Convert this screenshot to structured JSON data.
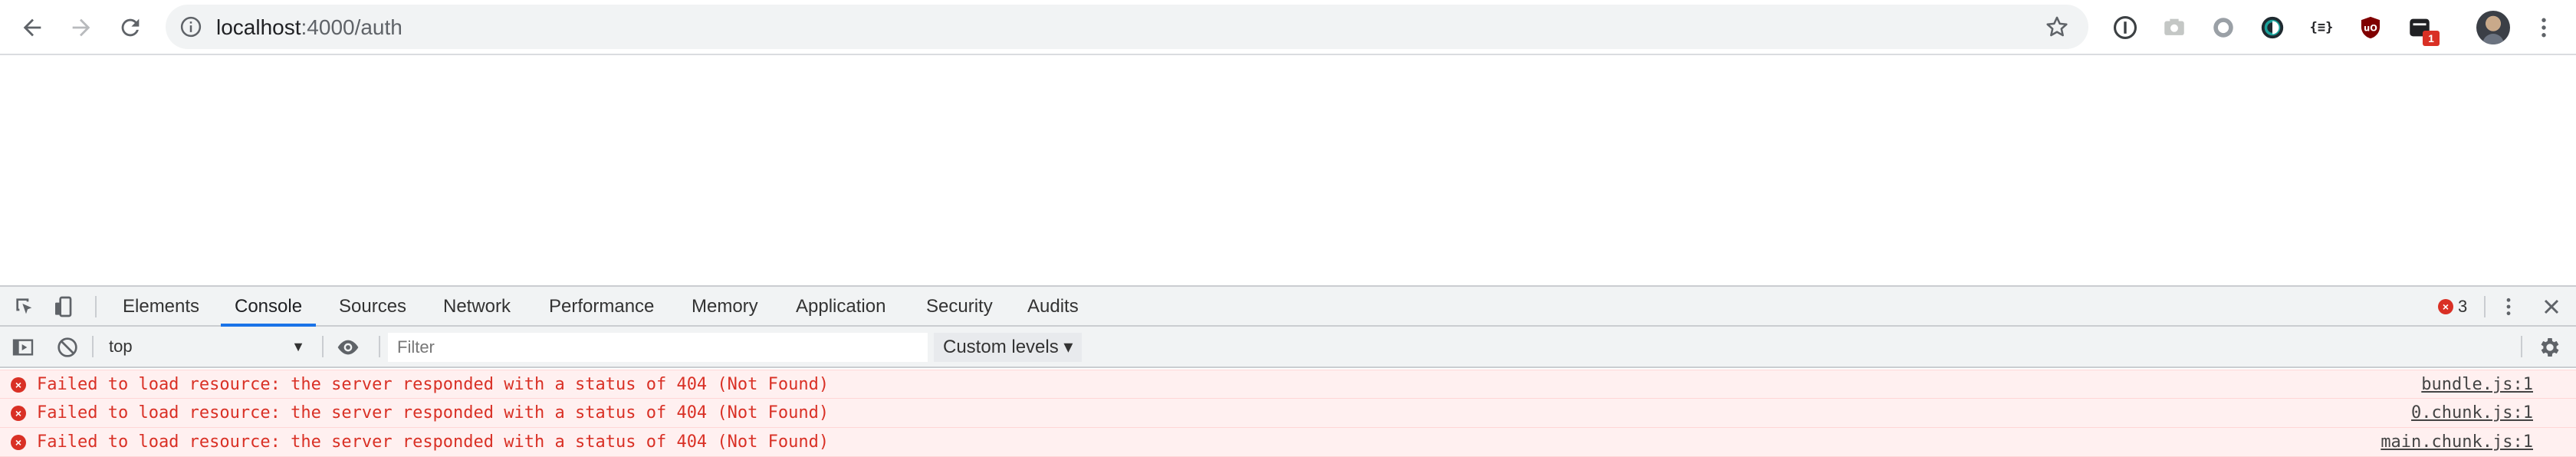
{
  "browser": {
    "url_host": "localhost",
    "url_path": ":4000/auth",
    "extensions": [
      {
        "name": "onepassword-icon"
      },
      {
        "name": "screenshot-ext-icon"
      },
      {
        "name": "circle-ext-icon"
      },
      {
        "name": "darkreader-icon"
      },
      {
        "name": "json-viewer-icon",
        "text": "{≡}"
      },
      {
        "name": "ublock-icon"
      },
      {
        "name": "devtools-ext-icon",
        "badge": "1"
      }
    ]
  },
  "devtools": {
    "tabs": [
      "Elements",
      "Console",
      "Sources",
      "Network",
      "Performance",
      "Memory",
      "Application",
      "Security",
      "Audits"
    ],
    "active_tab": "Console",
    "error_count": "3",
    "context": "top",
    "filter_placeholder": "Filter",
    "levels_label": "Custom levels ▾",
    "messages": [
      {
        "text": "Failed to load resource: the server responded with a status of 404 (Not Found)",
        "source": "bundle.js:1"
      },
      {
        "text": "Failed to load resource: the server responded with a status of 404 (Not Found)",
        "source": "0.chunk.js:1"
      },
      {
        "text": "Failed to load resource: the server responded with a status of 404 (Not Found)",
        "source": "main.chunk.js:1"
      }
    ]
  },
  "colors": {
    "error": "#d93025",
    "error_bg": "#fff0f0",
    "tab_active": "#1a73e8"
  }
}
